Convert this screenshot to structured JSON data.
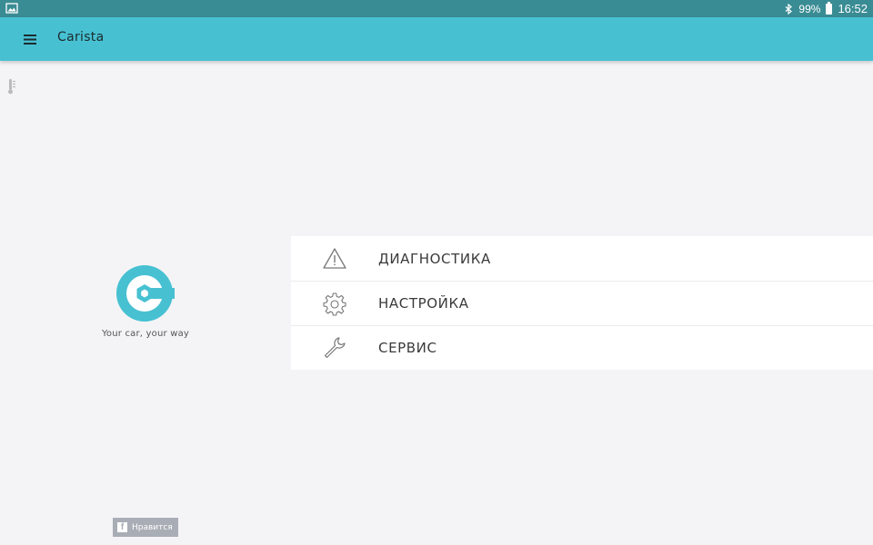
{
  "status_bar": {
    "battery": "99%",
    "time": "16:52",
    "icons": [
      "image-icon",
      "bluetooth-icon",
      "battery-icon"
    ]
  },
  "app_bar": {
    "title": "Carista",
    "menu_icon": "hamburger-menu-icon",
    "color": "#47c1d2"
  },
  "brand": {
    "tagline": "Your car, your way",
    "logo_color": "#47c1d2"
  },
  "menu": {
    "items": [
      {
        "label": "ДИАГНОСТИКА",
        "icon": "warning-triangle-icon"
      },
      {
        "label": "НАСТРОЙКА",
        "icon": "gear-icon"
      },
      {
        "label": "СЕРВИС",
        "icon": "wrench-icon"
      }
    ]
  },
  "social": {
    "fb_like_label": "Нравится",
    "fb_icon": "facebook-icon"
  }
}
